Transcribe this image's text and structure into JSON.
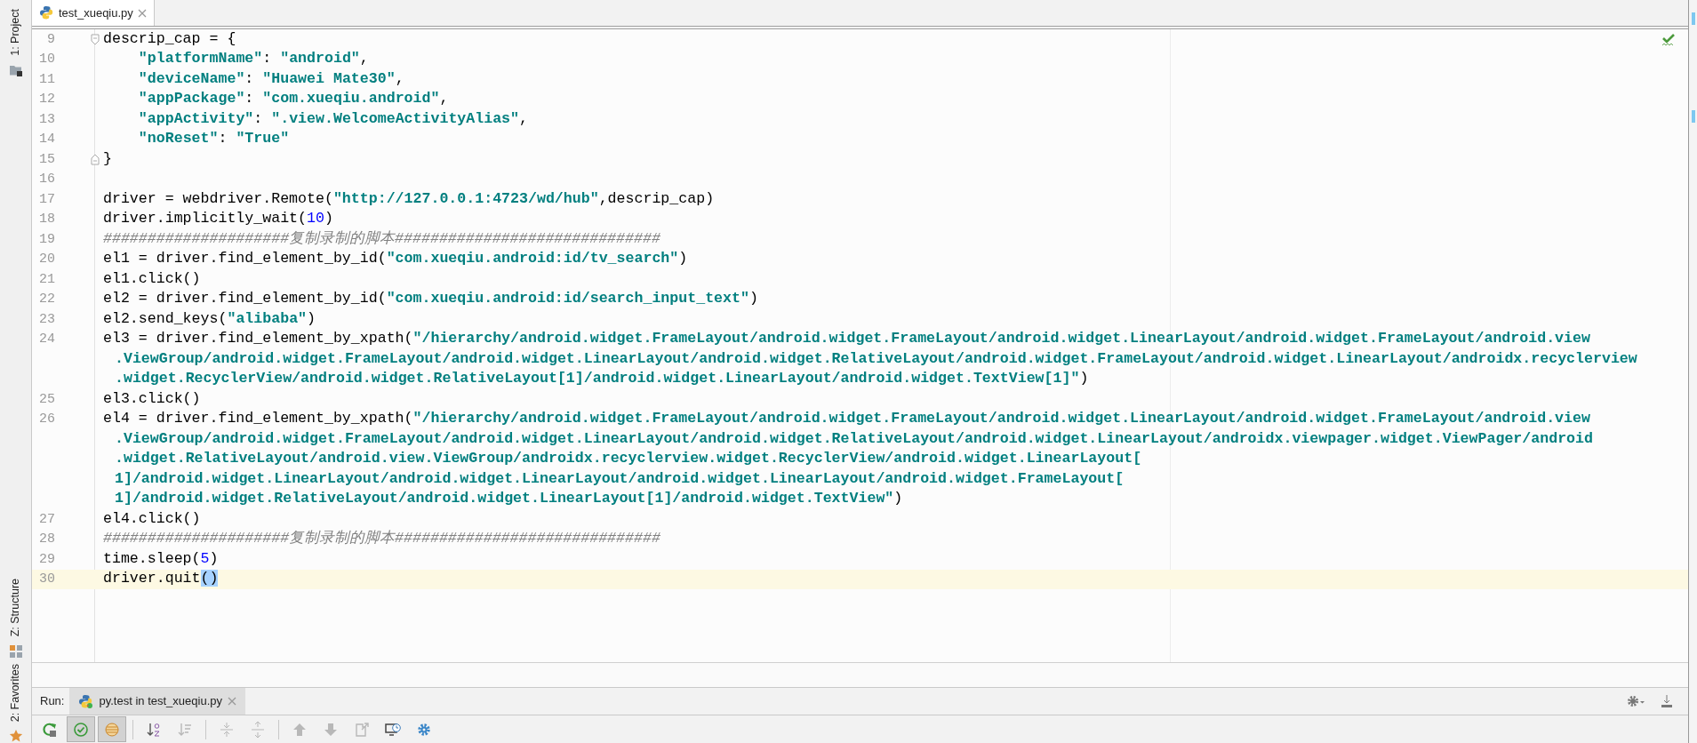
{
  "tool_window_stripe": [
    {
      "kind": "project",
      "label": "1: Project"
    },
    {
      "kind": "structure",
      "label": "Z: Structure"
    },
    {
      "kind": "favorites",
      "label": "2: Favorites"
    }
  ],
  "editor_tabs": [
    {
      "label": "test_xueqiu.py",
      "selected": true
    }
  ],
  "code_lines": [
    {
      "number": "9",
      "current": false,
      "fold_start": true,
      "rows": [
        [
          {
            "kind": "code",
            "text": "descrip_cap = {"
          }
        ]
      ]
    },
    {
      "number": "10",
      "current": false,
      "rows": [
        [
          {
            "kind": "code",
            "text": "    "
          },
          {
            "kind": "string",
            "text": "\"platformName\""
          },
          {
            "kind": "code",
            "text": ": "
          },
          {
            "kind": "string",
            "text": "\"android\""
          },
          {
            "kind": "code",
            "text": ","
          }
        ]
      ]
    },
    {
      "number": "11",
      "current": false,
      "rows": [
        [
          {
            "kind": "code",
            "text": "    "
          },
          {
            "kind": "string",
            "text": "\"deviceName\""
          },
          {
            "kind": "code",
            "text": ": "
          },
          {
            "kind": "string",
            "text": "\"Huawei Mate30\""
          },
          {
            "kind": "code",
            "text": ","
          }
        ]
      ]
    },
    {
      "number": "12",
      "current": false,
      "rows": [
        [
          {
            "kind": "code",
            "text": "    "
          },
          {
            "kind": "string",
            "text": "\"appPackage\""
          },
          {
            "kind": "code",
            "text": ": "
          },
          {
            "kind": "string",
            "text": "\"com.xueqiu.android\""
          },
          {
            "kind": "code",
            "text": ","
          }
        ]
      ]
    },
    {
      "number": "13",
      "current": false,
      "rows": [
        [
          {
            "kind": "code",
            "text": "    "
          },
          {
            "kind": "string",
            "text": "\"appActivity\""
          },
          {
            "kind": "code",
            "text": ": "
          },
          {
            "kind": "string",
            "text": "\".view.WelcomeActivityAlias\""
          },
          {
            "kind": "code",
            "text": ","
          }
        ]
      ]
    },
    {
      "number": "14",
      "current": false,
      "rows": [
        [
          {
            "kind": "code",
            "text": "    "
          },
          {
            "kind": "string",
            "text": "\"noReset\""
          },
          {
            "kind": "code",
            "text": ": "
          },
          {
            "kind": "string",
            "text": "\"True\""
          }
        ]
      ]
    },
    {
      "number": "15",
      "current": false,
      "fold_end": true,
      "rows": [
        [
          {
            "kind": "code",
            "text": "}"
          }
        ]
      ]
    },
    {
      "number": "16",
      "current": false
    },
    {
      "number": "17",
      "current": false,
      "rows": [
        [
          {
            "kind": "code",
            "text": "driver = webdriver.Remote("
          },
          {
            "kind": "string",
            "text": "\"http://127.0.0.1:4723/wd/hub\""
          },
          {
            "kind": "code",
            "text": ",descrip_cap)"
          }
        ]
      ]
    },
    {
      "number": "18",
      "current": false,
      "rows": [
        [
          {
            "kind": "code",
            "text": "driver.implicitly_wait("
          },
          {
            "kind": "number",
            "text": "10"
          },
          {
            "kind": "code",
            "text": ")"
          }
        ]
      ]
    },
    {
      "number": "19",
      "current": false,
      "rows": [
        [
          {
            "kind": "comment",
            "text": "#####################复制录制的脚本##############################"
          }
        ]
      ]
    },
    {
      "number": "20",
      "current": false,
      "rows": [
        [
          {
            "kind": "code",
            "text": "el1 = driver.find_element_by_id("
          },
          {
            "kind": "string",
            "text": "\"com.xueqiu.android:id/tv_search\""
          },
          {
            "kind": "code",
            "text": ")"
          }
        ]
      ]
    },
    {
      "number": "21",
      "current": false,
      "rows": [
        [
          {
            "kind": "code",
            "text": "el1.click()"
          }
        ]
      ]
    },
    {
      "number": "22",
      "current": false,
      "rows": [
        [
          {
            "kind": "code",
            "text": "el2 = driver.find_element_by_id("
          },
          {
            "kind": "string",
            "text": "\"com.xueqiu.android:id/search_input_text\""
          },
          {
            "kind": "code",
            "text": ")"
          }
        ]
      ]
    },
    {
      "number": "23",
      "current": false,
      "rows": [
        [
          {
            "kind": "code",
            "text": "el2.send_keys("
          },
          {
            "kind": "string",
            "text": "\"alibaba\""
          },
          {
            "kind": "code",
            "text": ")"
          }
        ]
      ]
    },
    {
      "number": "24",
      "current": false,
      "rows": [
        [
          {
            "kind": "code",
            "text": "el3 = driver.find_element_by_xpath("
          },
          {
            "kind": "string",
            "text": "\"/hierarchy/android.widget.FrameLayout/android.widget.FrameLayout/android.widget.LinearLayout/android.widget.FrameLayout/android.view"
          }
        ],
        [
          {
            "kind": "string",
            "text": ".ViewGroup/android.widget.FrameLayout/android.widget.LinearLayout/android.widget.RelativeLayout/android.widget.FrameLayout/android.widget.LinearLayout/androidx.recyclerview"
          }
        ],
        [
          {
            "kind": "string",
            "text": ".widget.RecyclerView/android.widget.RelativeLayout[1]/android.widget.LinearLayout/android.widget.TextView[1]\""
          },
          {
            "kind": "code",
            "text": ")"
          }
        ]
      ]
    },
    {
      "number": "25",
      "current": false,
      "rows": [
        [
          {
            "kind": "code",
            "text": "el3.click()"
          }
        ]
      ]
    },
    {
      "number": "26",
      "current": false,
      "rows": [
        [
          {
            "kind": "code",
            "text": "el4 = driver.find_element_by_xpath("
          },
          {
            "kind": "string",
            "text": "\"/hierarchy/android.widget.FrameLayout/android.widget.FrameLayout/android.widget.LinearLayout/android.widget.FrameLayout/android.view"
          }
        ],
        [
          {
            "kind": "string",
            "text": ".ViewGroup/android.widget.FrameLayout/android.widget.LinearLayout/android.widget.RelativeLayout/android.widget.LinearLayout/androidx.viewpager.widget.ViewPager/android"
          }
        ],
        [
          {
            "kind": "string",
            "text": ".widget.RelativeLayout/android.view.ViewGroup/androidx.recyclerview.widget.RecyclerView/android.widget.LinearLayout["
          }
        ],
        [
          {
            "kind": "string",
            "text": "1]/android.widget.LinearLayout/android.widget.LinearLayout/android.widget.LinearLayout/android.widget.FrameLayout["
          }
        ],
        [
          {
            "kind": "string",
            "text": "1]/android.widget.RelativeLayout/android.widget.LinearLayout[1]/android.widget.TextView\""
          },
          {
            "kind": "code",
            "text": ")"
          }
        ]
      ]
    },
    {
      "number": "27",
      "current": false,
      "rows": [
        [
          {
            "kind": "code",
            "text": "el4.click()"
          }
        ]
      ]
    },
    {
      "number": "28",
      "current": false,
      "rows": [
        [
          {
            "kind": "comment",
            "text": "#####################复制录制的脚本##############################"
          }
        ]
      ]
    },
    {
      "number": "29",
      "current": false,
      "rows": [
        [
          {
            "kind": "code",
            "text": "time.sleep("
          },
          {
            "kind": "number",
            "text": "5"
          },
          {
            "kind": "code",
            "text": ")"
          }
        ]
      ]
    },
    {
      "number": "30",
      "current": true,
      "rows": [
        [
          {
            "kind": "code",
            "text": "driver.quit"
          },
          {
            "kind": "selection",
            "text": "()"
          }
        ]
      ]
    }
  ],
  "run_panel": {
    "title": "Run:",
    "tabs": [
      {
        "label": "py.test in test_xueqiu.py",
        "selected": true
      }
    ],
    "toolbar": [
      {
        "kind": "rerun",
        "pressed": false,
        "disabled": false
      },
      {
        "kind": "show-passed",
        "pressed": true,
        "disabled": false
      },
      {
        "kind": "show-ignored",
        "pressed": true,
        "disabled": false
      },
      {
        "kind": "separator"
      },
      {
        "kind": "sort-alpha",
        "pressed": false,
        "disabled": false
      },
      {
        "kind": "sort-duration",
        "pressed": false,
        "disabled": true
      },
      {
        "kind": "separator"
      },
      {
        "kind": "expand-all",
        "pressed": false,
        "disabled": true
      },
      {
        "kind": "collapse-all",
        "pressed": false,
        "disabled": true
      },
      {
        "kind": "separator"
      },
      {
        "kind": "previous",
        "pressed": false,
        "disabled": true
      },
      {
        "kind": "next",
        "pressed": false,
        "disabled": true
      },
      {
        "kind": "export",
        "pressed": false,
        "disabled": true
      },
      {
        "kind": "history",
        "pressed": false,
        "disabled": false
      },
      {
        "kind": "settings",
        "pressed": false,
        "disabled": false
      }
    ]
  }
}
